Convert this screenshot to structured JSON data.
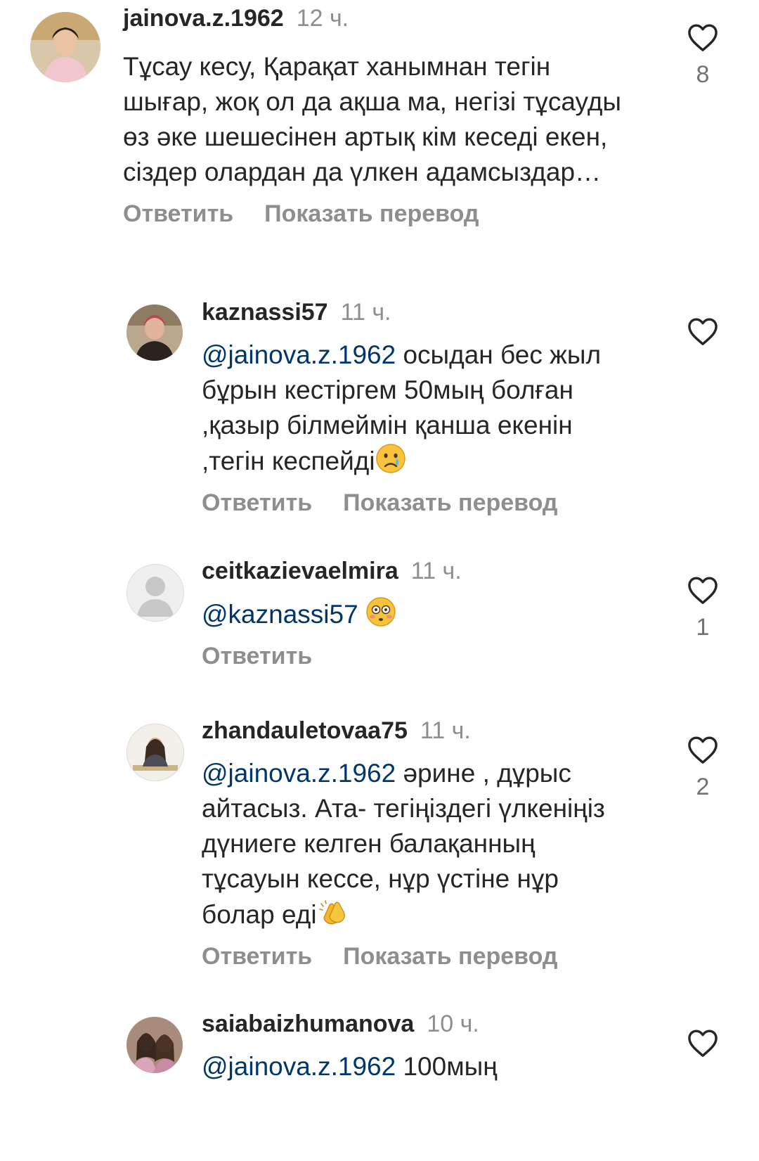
{
  "comments": [
    {
      "username": "jainova.z.1962",
      "time": "12 ч.",
      "mention": "",
      "text": "Тұсау кесу, Қарақат ханымнан тегін шығар, жоқ ол да ақша ма, негізі тұсауды өз әке шешесінен артық кім кеседі екен, сіздер олардан да үлкен адамсыздар…",
      "likes": "8",
      "reply_label": "Ответить",
      "translate_label": "Показать перевод"
    },
    {
      "username": "kaznassi57",
      "time": "11 ч.",
      "mention": "@jainova.z.1962",
      "text": " осыдан бес жыл бұрын кестіргем 50мың болған ,қазыр білмеймін қанша екенін ,тегін кеспейді",
      "emoji": "crying-face",
      "likes": "",
      "reply_label": "Ответить",
      "translate_label": "Показать перевод"
    },
    {
      "username": "ceitkazievaelmira",
      "time": "11 ч.",
      "mention": "@kaznassi57",
      "text": " ",
      "emoji": "flushed-face",
      "likes": "1",
      "reply_label": "Ответить"
    },
    {
      "username": "zhandauletovaa75",
      "time": "11 ч.",
      "mention": "@jainova.z.1962",
      "text": " әрине , дұрыс айтасыз. Ата- тегіңіздегі үлкеніңіз дүниеге келген балақанның тұсауын кессе, нұр үстіне нұр болар еді",
      "emoji": "clapping-hands",
      "likes": "2",
      "reply_label": "Ответить",
      "translate_label": "Показать перевод"
    },
    {
      "username": "saiabaizhumanova",
      "time": "10 ч.",
      "mention": "@jainova.z.1962",
      "text": " 100мың",
      "likes": ""
    }
  ],
  "colors": {
    "text": "#262626",
    "secondary": "#8e8e8e",
    "mention": "#00376b",
    "background": "#ffffff"
  },
  "icons": {
    "like": "heart-outline-icon"
  }
}
